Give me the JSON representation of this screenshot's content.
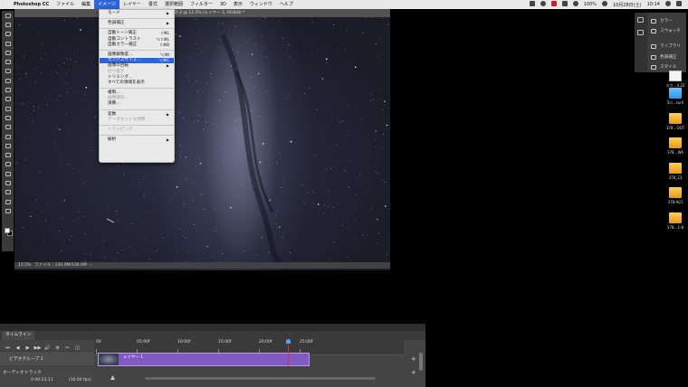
{
  "menubar": {
    "app": "Photoshop CC",
    "items": [
      "ファイル",
      "編集",
      "イメージ",
      "レイヤー",
      "書式",
      "選択範囲",
      "フィルター",
      "3D",
      "表示",
      "ウィンドウ",
      "ヘルプ"
    ],
    "active": "イメージ",
    "battery": "100%",
    "date": "10月28日(土)",
    "time": "10:14"
  },
  "document": {
    "tab_title": "近-2 @ 12.5% (レイヤー 1, RGB/8) *",
    "zoom": "12.5%",
    "file_info": "ファイル : 130.0M/130.0M"
  },
  "image_menu": {
    "items": [
      {
        "label": "モード",
        "shortcut": "",
        "submenu": true,
        "disabled": false
      },
      {
        "sep": true
      },
      {
        "label": "色調補正",
        "shortcut": "",
        "submenu": true,
        "disabled": false
      },
      {
        "sep": true
      },
      {
        "label": "自動トーン補正",
        "shortcut": "⇧⌘L",
        "disabled": false
      },
      {
        "label": "自動コントラスト",
        "shortcut": "⌥⇧⌘L",
        "disabled": false
      },
      {
        "label": "自動カラー補正",
        "shortcut": "⇧⌘B",
        "disabled": false
      },
      {
        "sep": true
      },
      {
        "label": "画像解像度...",
        "shortcut": "⌥⌘I",
        "disabled": false
      },
      {
        "label": "カンバスサイズ...",
        "shortcut": "⌥⌘C",
        "disabled": false,
        "highlighted": true
      },
      {
        "label": "画像の回転",
        "shortcut": "",
        "submenu": true,
        "disabled": false
      },
      {
        "label": "切り抜き",
        "shortcut": "",
        "disabled": true
      },
      {
        "label": "トリミング...",
        "shortcut": "",
        "disabled": false
      },
      {
        "label": "すべての領域を表示",
        "shortcut": "",
        "disabled": false
      },
      {
        "sep": true
      },
      {
        "label": "複製...",
        "shortcut": "",
        "disabled": false
      },
      {
        "label": "画像操作...",
        "shortcut": "",
        "disabled": true
      },
      {
        "label": "演算...",
        "shortcut": "",
        "disabled": false
      },
      {
        "sep": true
      },
      {
        "label": "変数",
        "shortcut": "",
        "submenu": true,
        "disabled": false
      },
      {
        "label": "データセットを適用...",
        "shortcut": "",
        "disabled": true
      },
      {
        "sep": true
      },
      {
        "label": "トラッピング...",
        "shortcut": "",
        "disabled": true
      },
      {
        "sep": true
      },
      {
        "label": "解析",
        "shortcut": "",
        "submenu": true,
        "disabled": false
      }
    ]
  },
  "right_panel": {
    "items": [
      "カラー",
      "スウォッチ",
      "ライブラリ",
      "色調補正",
      "スタイル"
    ]
  },
  "desktop": {
    "icons": [
      {
        "label": "スク…4.22",
        "kind": "file"
      },
      {
        "label": "5cr…turé",
        "kind": "folder"
      },
      {
        "label": "378…OOT",
        "kind": "drive"
      },
      {
        "label": "378…WA",
        "kind": "drive"
      },
      {
        "label": "378_23",
        "kind": "drive"
      },
      {
        "label": "378-A01",
        "kind": "drive"
      },
      {
        "label": "378…1-8",
        "kind": "drive"
      }
    ]
  },
  "timeline": {
    "tab": "タイムライン",
    "ticks": [
      "00",
      "05:00f",
      "10:00f",
      "15:00f",
      "20:00f",
      "25:00f"
    ],
    "playhead_fraction": 0.63,
    "video_group": "ビデオグループ 1",
    "clip": "レイヤー 1",
    "audio_track": "オーディオトラック",
    "timecode": "0:00:23:11",
    "fps": "(30.00 fps)",
    "controls": [
      "⏮",
      "◀",
      "▶",
      "▶▶",
      "🔊",
      "⚙",
      "✂",
      "◫"
    ]
  }
}
